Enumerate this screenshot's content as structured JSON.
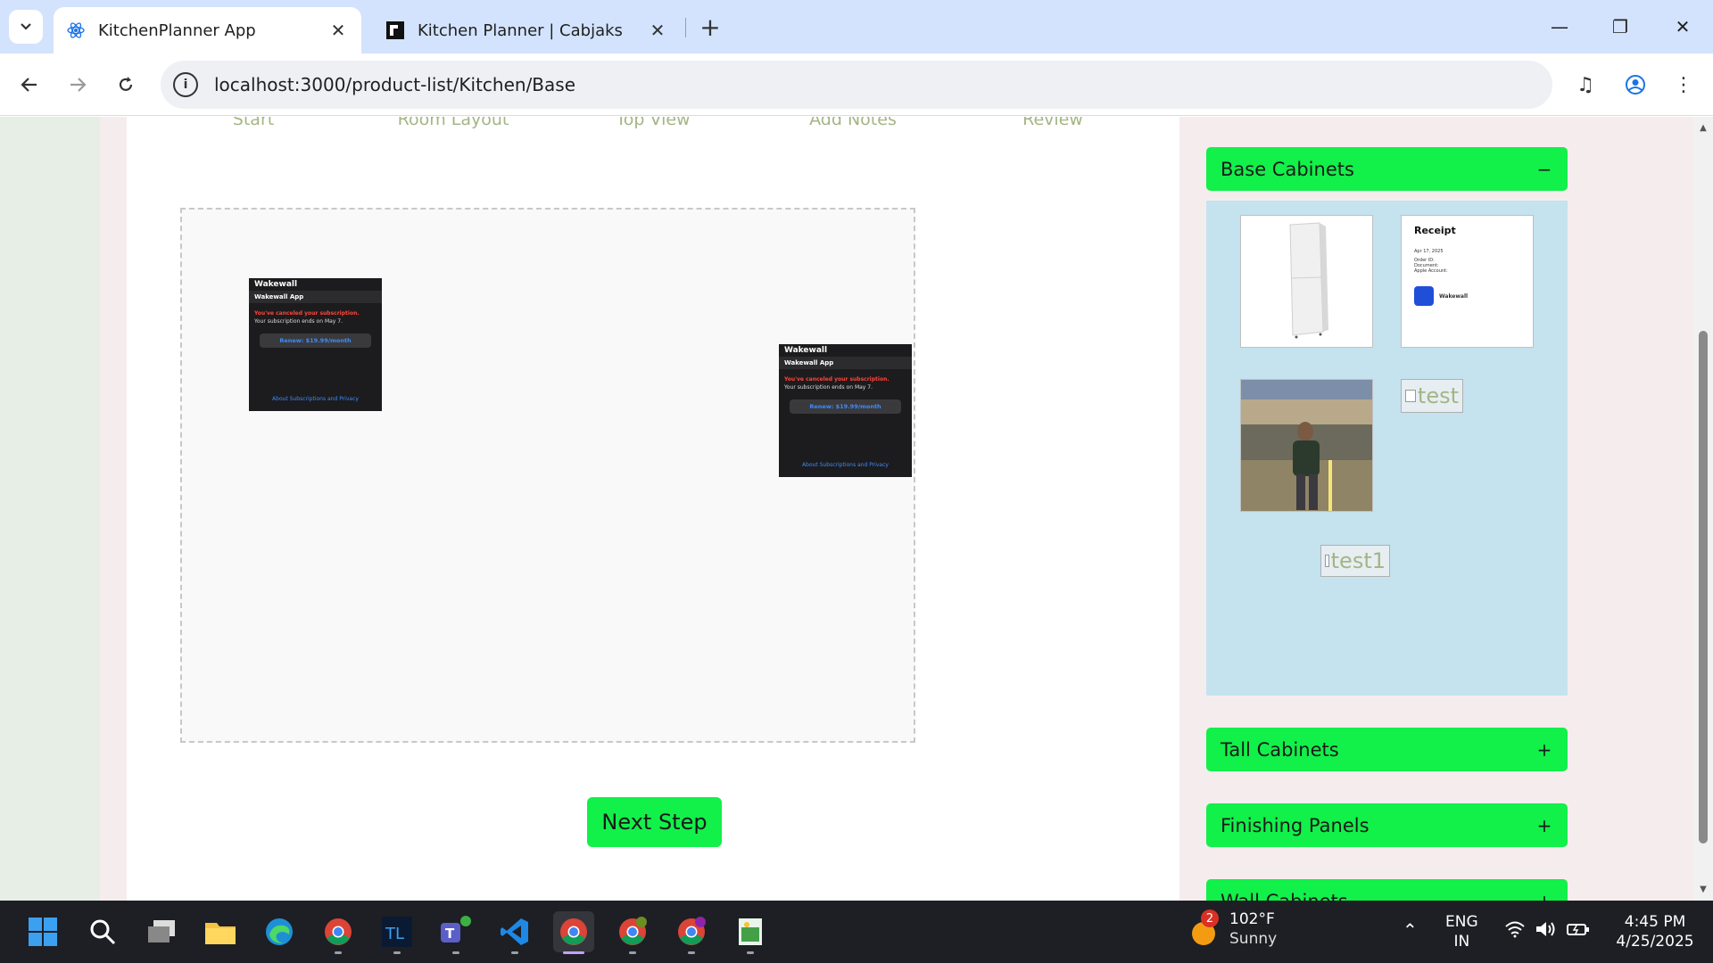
{
  "browser": {
    "tabs": [
      {
        "title": "KitchenPlanner App",
        "active": true,
        "icon": "react-icon"
      },
      {
        "title": "Kitchen Planner | Cabjaks",
        "active": false,
        "icon": "cabjaks-icon"
      }
    ],
    "url": "localhost:3000/product-list/Kitchen/Base"
  },
  "steps": [
    "Start",
    "Room Layout",
    "Top View",
    "Add Notes",
    "Review"
  ],
  "canvas_items": [
    {
      "app": "Wakewall",
      "subtitle": "Wakewall App",
      "cancel": "You've canceled your subscription.",
      "ends": "Your subscription ends on May 7.",
      "renew": "Renew: $19.99/month",
      "about": "About Subscriptions and Privacy"
    },
    {
      "app": "Wakewall",
      "subtitle": "Wakewall App",
      "cancel": "You've canceled your subscription.",
      "ends": "Your subscription ends on May 7.",
      "renew": "Renew: $19.99/month",
      "about": "About Subscriptions and Privacy"
    }
  ],
  "next_button": "Next Step",
  "accordion": {
    "sections": [
      {
        "label": "Base Cabinets",
        "sign": "−"
      },
      {
        "label": "Tall Cabinets",
        "sign": "+"
      },
      {
        "label": "Finishing Panels",
        "sign": "+"
      },
      {
        "label": "Wall Cabinets",
        "sign": "+"
      }
    ],
    "products": {
      "receipt_title": "Receipt",
      "receipt_lines": [
        "Apr 17, 2025",
        "Order ID:",
        "Document:",
        "Apple Account:"
      ],
      "receipt_app": "Wakewall",
      "broken_1": "test",
      "broken_2": "test1"
    }
  },
  "taskbar": {
    "weather_temp": "102°F",
    "weather_desc": "Sunny",
    "weather_badge": "2",
    "lang_1": "ENG",
    "lang_2": "IN",
    "time": "4:45 PM",
    "date": "4/25/2025"
  },
  "colors": {
    "accent_green": "#12f04a",
    "step_text": "#a4b585",
    "panel_blue": "#c5e2ef"
  }
}
